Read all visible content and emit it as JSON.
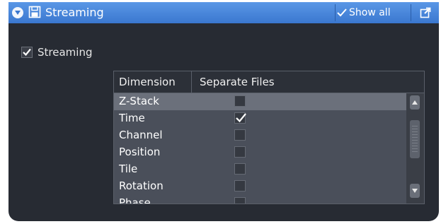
{
  "header": {
    "title": "Streaming",
    "show_all_label": "Show all",
    "icons": [
      "collapse-arrow-icon",
      "save-icon",
      "checkmark-icon",
      "undock-icon"
    ]
  },
  "streaming_option": {
    "label": "Streaming",
    "checked": true
  },
  "table": {
    "columns": [
      "Dimension",
      "Separate Files"
    ],
    "rows": [
      {
        "dimension": "Z-Stack",
        "separate_files": false,
        "selected": true
      },
      {
        "dimension": "Time",
        "separate_files": true,
        "selected": false
      },
      {
        "dimension": "Channel",
        "separate_files": false,
        "selected": false
      },
      {
        "dimension": "Position",
        "separate_files": false,
        "selected": false
      },
      {
        "dimension": "Tile",
        "separate_files": false,
        "selected": false
      },
      {
        "dimension": "Rotation",
        "separate_files": false,
        "selected": false
      },
      {
        "dimension": "Phase",
        "separate_files": false,
        "selected": false
      }
    ]
  },
  "colors": {
    "header_blue": "#3a77cf",
    "panel_background": "#272b33",
    "table_background": "#4a4f5a",
    "selected_row": "#6b707b"
  }
}
